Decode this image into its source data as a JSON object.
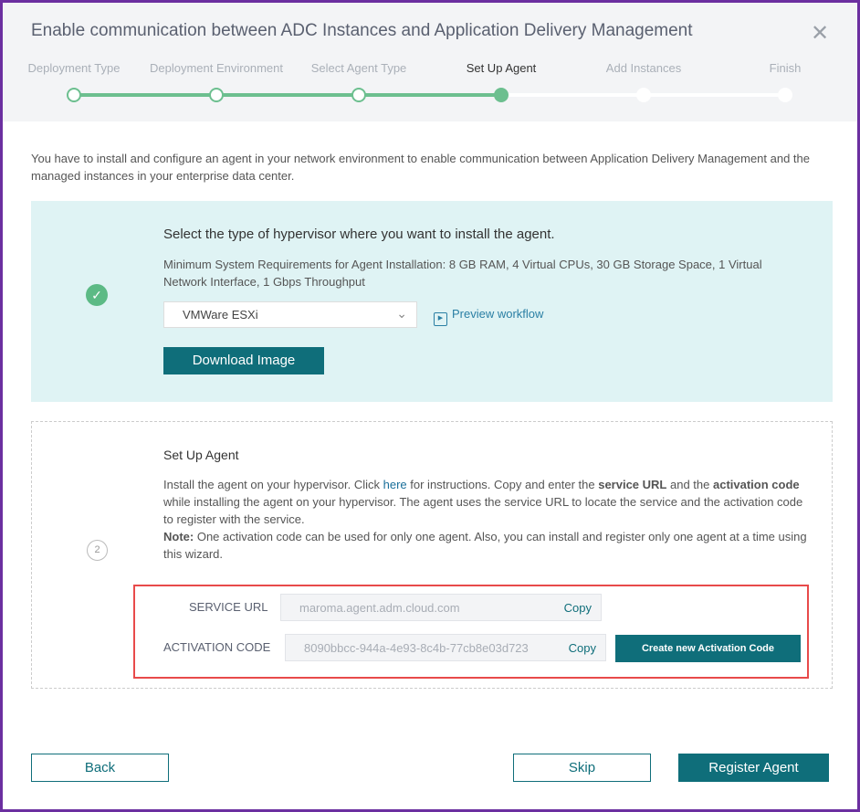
{
  "dialog": {
    "title": "Enable communication between ADC Instances and Application Delivery Management",
    "close_icon": "close-icon"
  },
  "steps": [
    {
      "label": "Deployment Type",
      "state": "done"
    },
    {
      "label": "Deployment Environment",
      "state": "done"
    },
    {
      "label": "Select Agent Type",
      "state": "done"
    },
    {
      "label": "Set Up Agent",
      "state": "active"
    },
    {
      "label": "Add Instances",
      "state": "pending"
    },
    {
      "label": "Finish",
      "state": "pending"
    }
  ],
  "colors": {
    "accent": "#0f6e7a",
    "progress": "#6cbf8f",
    "highlight": "#e84a4a",
    "panel": "#dff3f4"
  },
  "intro": "You have to install and configure an agent in your network environment to enable communication between Application Delivery Management and the managed instances in your enterprise data center.",
  "step1": {
    "heading": "Select the type of hypervisor where you want to install the agent.",
    "requirements": "Minimum System Requirements for Agent Installation: 8 GB RAM, 4 Virtual CPUs, 30 GB Storage Space, 1 Virtual Network Interface, 1 Gbps Throughput",
    "hypervisor": "VMWare ESXi",
    "preview": "Preview workflow",
    "download": "Download Image"
  },
  "step2": {
    "number": "2",
    "heading": "Set Up Agent",
    "p1": "Install the agent on your hypervisor. Click ",
    "here": "here",
    "p2": " for instructions. Copy and enter the ",
    "b1": "service URL",
    "p3": " and the ",
    "b2": "activation code",
    "p4": " while installing the agent on your hypervisor. The agent uses the service URL to locate the service and the activation code to register with the service.",
    "note_label": "Note:",
    "note": " One activation code can be used for only one agent. Also, you can install and register only one agent at a time using this wizard.",
    "service_url_label": "SERVICE URL",
    "service_url": "maroma.agent.adm.cloud.com",
    "activation_label": "ACTIVATION CODE",
    "activation_code": "8090bbcc-944a-4e93-8c4b-77cb8e03d723",
    "copy": "Copy",
    "create_code": "Create new Activation Code"
  },
  "footer": {
    "back": "Back",
    "skip": "Skip",
    "register": "Register Agent"
  }
}
